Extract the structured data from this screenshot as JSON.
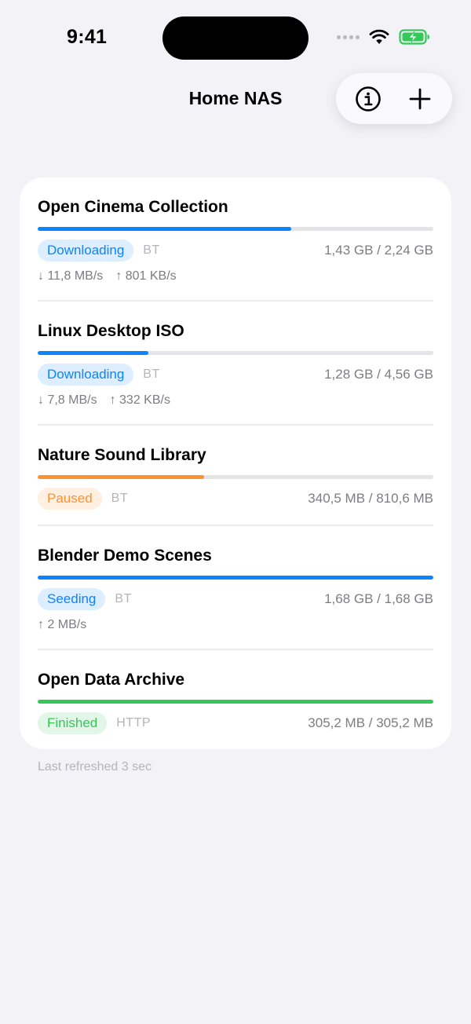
{
  "status_bar": {
    "time": "9:41",
    "signal_icon": "signal-dots-icon",
    "wifi_icon": "wifi-icon",
    "battery_icon": "battery-charging-icon",
    "battery_color": "#34c759"
  },
  "nav": {
    "title": "Home NAS",
    "info_icon": "info-circle-icon",
    "add_icon": "plus-icon"
  },
  "colors": {
    "blue": "#0a84ff",
    "orange": "#ff9230",
    "green": "#34c759",
    "background": "#f2f2f7"
  },
  "items": [
    {
      "name": "Open Cinema Collection",
      "progress": 0.64,
      "status": "Downloading",
      "status_color": "#0a84ff",
      "protocol": "BT",
      "size": "1,43 GB / 2,24 GB",
      "down": "↓ 11,8 MB/s",
      "up": "↑ 801 KB/s"
    },
    {
      "name": "Linux Desktop ISO",
      "progress": 0.28,
      "status": "Downloading",
      "status_color": "#0a84ff",
      "protocol": "BT",
      "size": "1,28 GB / 4,56 GB",
      "down": "↓ 7,8 MB/s",
      "up": "↑ 332 KB/s"
    },
    {
      "name": "Nature Sound Library",
      "progress": 0.42,
      "status": "Paused",
      "status_color": "#ff9230",
      "protocol": "BT",
      "size": "340,5 MB / 810,6 MB"
    },
    {
      "name": "Blender Demo Scenes",
      "progress": 1.0,
      "status": "Seeding",
      "status_color": "#0a84ff",
      "protocol": "BT",
      "size": "1,68 GB / 1,68 GB",
      "up": "↑ 2 MB/s"
    },
    {
      "name": "Open Data Archive",
      "progress": 1.0,
      "status": "Finished",
      "status_color": "#34c759",
      "protocol": "HTTP",
      "size": "305,2 MB / 305,2 MB"
    }
  ],
  "footer": {
    "text": "Last refreshed 3 sec"
  }
}
